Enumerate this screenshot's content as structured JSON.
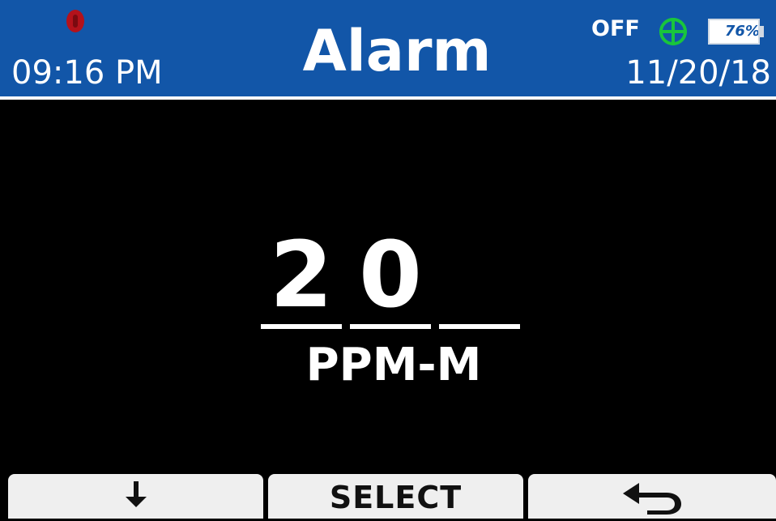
{
  "header": {
    "time": "09:16 PM",
    "title": "Alarm",
    "date": "11/20/18",
    "gps_state": "OFF",
    "battery_label": "76%",
    "battery_level_percent": 76,
    "colors": {
      "header_bg": "#1256a8",
      "status_dot": "#b3121b",
      "gps_icon": "#19c53c"
    },
    "icons": {
      "status": "record-status-icon",
      "gps": "gps-crosshair-icon",
      "battery": "battery-icon"
    }
  },
  "main": {
    "digits": [
      "2",
      "0",
      ""
    ],
    "unit": "PPM-M"
  },
  "softkeys": {
    "left_icon": "arrow-down-icon",
    "center_label": "SELECT",
    "right_icon": "return-arrow-icon"
  }
}
